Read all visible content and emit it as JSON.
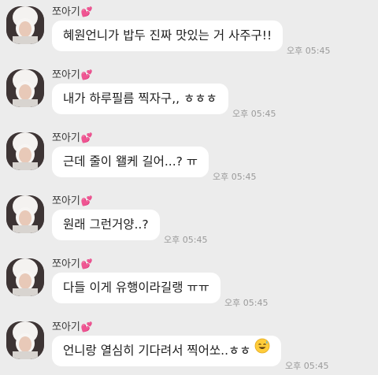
{
  "sender_name": "쪼아기",
  "heart_icon": "💕",
  "messages": [
    {
      "text": "혜원언니가 밥두 진짜 맛있는 거 사주구!!",
      "time": "오후 05:45"
    },
    {
      "text": "내가 하루필름 찍자구,, ㅎㅎㅎ",
      "time": "오후 05:45"
    },
    {
      "text": "근데 줄이 왤케 길어...? ㅠ",
      "time": "오후 05:45"
    },
    {
      "text": "원래 그런거양..?",
      "time": "오후 05:45"
    },
    {
      "text": "다들 이게 유행이라길랭 ㅠㅠ",
      "time": "오후 05:45"
    },
    {
      "text": "언니랑 열심히 기다려서 찍어쏘..ㅎㅎ",
      "time": "오후 05:45",
      "emoji": "sweat-smile-emoji"
    }
  ],
  "colors": {
    "background": "#ececec",
    "bubble": "#ffffff",
    "heart": "#ff4fa3"
  }
}
